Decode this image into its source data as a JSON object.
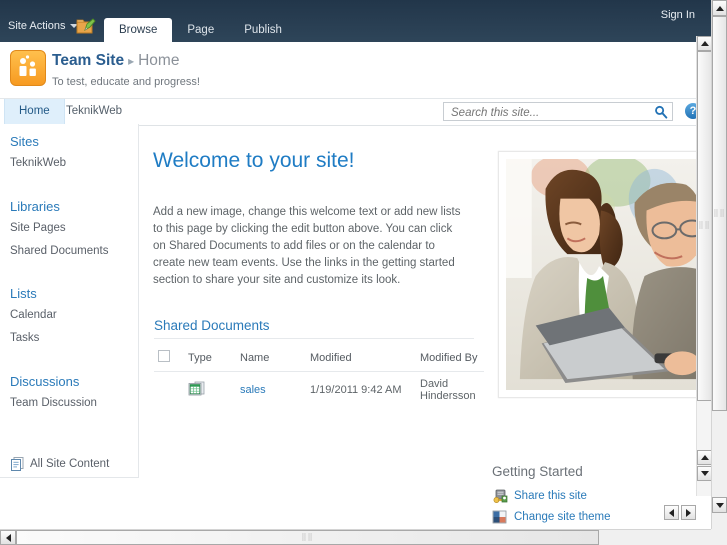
{
  "ribbon": {
    "site_actions": "Site Actions",
    "edit_icon": "edit-page-icon",
    "tabs": [
      {
        "label": "Browse",
        "active": true
      },
      {
        "label": "Page",
        "active": false
      },
      {
        "label": "Publish",
        "active": false
      }
    ],
    "sign_in": "Sign In"
  },
  "header": {
    "logo_icon": "team-site-logo-icon",
    "site_name": "Team Site",
    "separator": "▸",
    "page_name": "Home",
    "tagline": "To test, educate and progress!"
  },
  "nav": {
    "tabs": [
      {
        "label": "Home",
        "active": true
      },
      {
        "label": "TeknikWeb",
        "active": false
      }
    ],
    "search": {
      "placeholder": "Search this site...",
      "value": "",
      "icon": "search-icon"
    },
    "help_icon": "help-icon",
    "help_glyph": "?"
  },
  "sidebar": {
    "groups": [
      {
        "title": "Sites",
        "items": [
          "TeknikWeb"
        ]
      },
      {
        "title": "Libraries",
        "items": [
          "Site Pages",
          "Shared Documents"
        ]
      },
      {
        "title": "Lists",
        "items": [
          "Calendar",
          "Tasks"
        ]
      },
      {
        "title": "Discussions",
        "items": [
          "Team Discussion"
        ]
      }
    ],
    "all_site_content": "All Site Content",
    "all_site_content_icon": "documents-icon"
  },
  "main": {
    "welcome_title": "Welcome to your site!",
    "welcome_body": "Add a new image, change this welcome text or add new lists to this page by clicking the edit button above. You can click on Shared Documents to add files or on the calendar to create new team events. Use the links in the getting started section to share your site and customize its look.",
    "photo_alt": "two colleagues looking at a laptop",
    "shared_documents": {
      "title": "Shared Documents",
      "columns": [
        "Type",
        "Name",
        "Modified",
        "Modified By"
      ],
      "rows": [
        {
          "type_icon": "excel-document-icon",
          "name": "sales",
          "modified": "1/19/2011 9:42 AM",
          "modified_by": "David Hindersson"
        }
      ]
    },
    "getting_started": {
      "title": "Getting Started",
      "items": [
        {
          "label": "Share this site",
          "icon": "share-site-icon"
        },
        {
          "label": "Change site theme",
          "icon": "theme-palette-icon"
        }
      ]
    }
  },
  "colors": {
    "ribbon_dark": "#22364a",
    "accent_blue": "#2a7ab9",
    "title_blue": "#1f7cc4",
    "logo_orange": "#f79a21",
    "active_tab_bg": "#dfeffb"
  }
}
